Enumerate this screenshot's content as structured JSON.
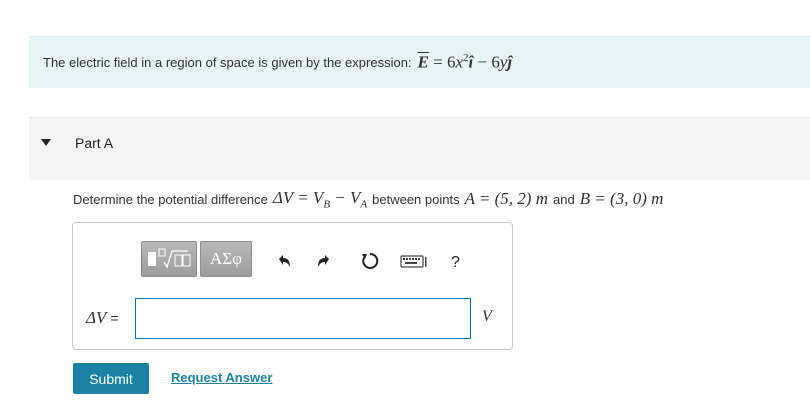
{
  "problem": {
    "statement": "The electric field in a region of space is given by the expression:",
    "field_symbol": "E",
    "field_expression_coef1": "6",
    "field_expression_var1": "x",
    "field_expression_exp1": "2",
    "field_expression_unit1": "î",
    "field_expression_op": "−",
    "field_expression_coef2": "6",
    "field_expression_var2": "y",
    "field_expression_unit2": "ĵ"
  },
  "part": {
    "title": "Part A",
    "question_prefix": "Determine the potential difference",
    "question_expr": "ΔV = V",
    "question_b": "B",
    "question_minus": " − V",
    "question_a": "A",
    "question_middle": "between points",
    "point_a": "A = (5, 2) m",
    "point_and": "and",
    "point_b": "B = (3, 0) m"
  },
  "toolbar": {
    "symbols_label": "ΑΣφ",
    "help_label": "?"
  },
  "answer": {
    "label_symbol": "ΔV",
    "label_eq": "=",
    "value": "",
    "unit": "V"
  },
  "actions": {
    "submit_label": "Submit",
    "request_label": "Request Answer"
  },
  "colors": {
    "accent": "#1b82a6",
    "problem_bg": "#e6f4f5",
    "part_bg": "#f5f5f5",
    "input_border": "#0077b3"
  }
}
